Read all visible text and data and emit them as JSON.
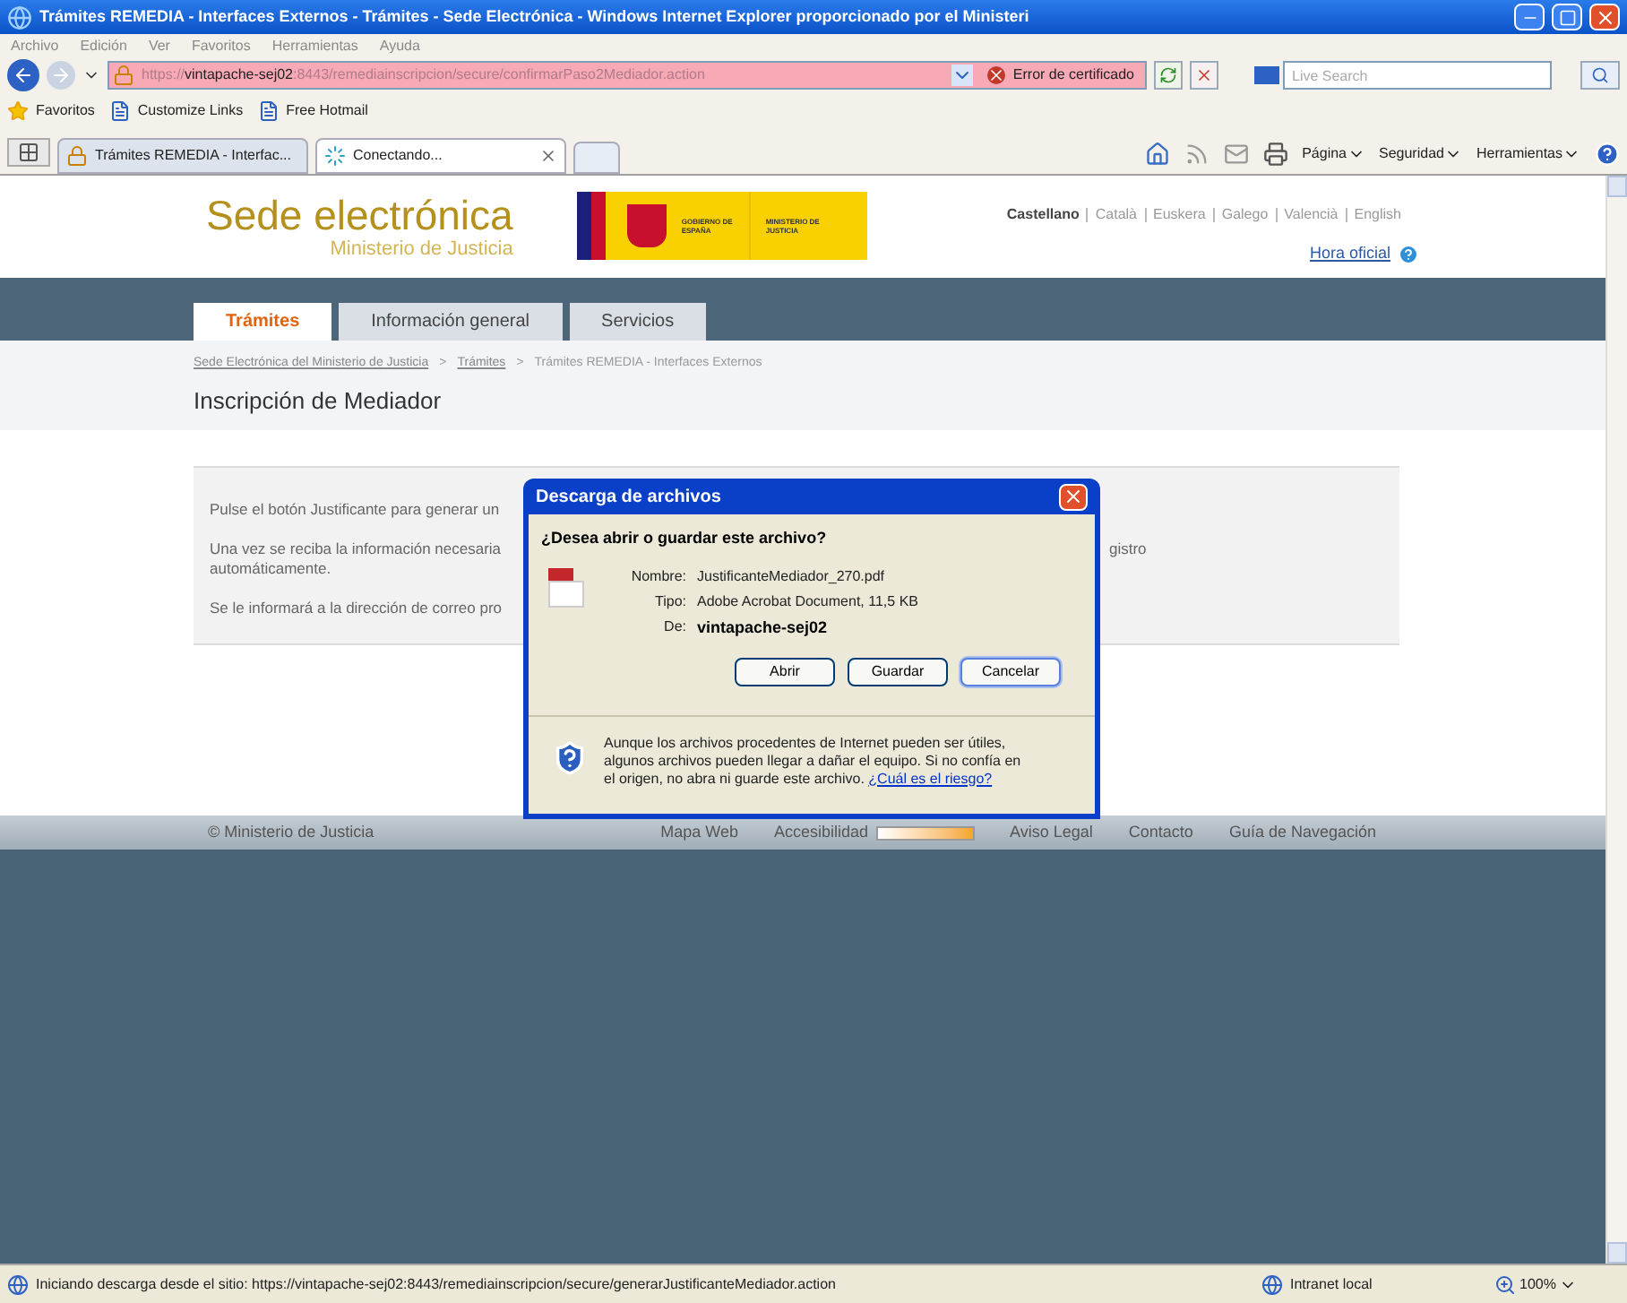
{
  "window": {
    "title": "Trámites REMEDIA - Interfaces Externos - Trámites - Sede Electrónica - Windows Internet Explorer proporcionado por el Ministeri"
  },
  "menu": [
    "Archivo",
    "Edición",
    "Ver",
    "Favoritos",
    "Herramientas",
    "Ayuda"
  ],
  "address_bar": {
    "scheme": "https://",
    "host": "vintapache-sej02",
    "path": ":8443/remediainscripcion/secure/confirmarPaso2Mediador.action",
    "certificate_error": "Error de certificado"
  },
  "search": {
    "placeholder": "Live Search"
  },
  "favorites_bar": [
    "Favoritos",
    "Customize Links",
    "Free Hotmail"
  ],
  "browser_tabs": [
    {
      "label": "Trámites REMEDIA - Interfac...",
      "selected": false
    },
    {
      "label": "Conectando...",
      "selected": true
    }
  ],
  "command_bar": [
    "Página",
    "Seguridad",
    "Herramientas"
  ],
  "page": {
    "site_title": "Sede electrónica",
    "site_subtitle": "Ministerio de Justicia",
    "logo": {
      "left": "GOBIERNO DE ESPAÑA",
      "right": "MINISTERIO DE JUSTICIA"
    },
    "languages": [
      {
        "label": "Castellano",
        "selected": true
      },
      {
        "label": "Català",
        "selected": false
      },
      {
        "label": "Euskera",
        "selected": false
      },
      {
        "label": "Galego",
        "selected": false
      },
      {
        "label": "Valencià",
        "selected": false
      },
      {
        "label": "English",
        "selected": false
      }
    ],
    "official_time": "Hora oficial",
    "nav_tabs": [
      {
        "label": "Trámites",
        "selected": true
      },
      {
        "label": "Información general",
        "selected": false
      },
      {
        "label": "Servicios",
        "selected": false
      }
    ],
    "breadcrumb": [
      {
        "label": "Sede Electrónica del Ministerio de Justicia",
        "link": true
      },
      {
        "label": ">",
        "link": false
      },
      {
        "label": "Trámites",
        "link": true
      },
      {
        "label": ">",
        "link": false
      },
      {
        "label": "Trámites REMEDIA - Interfaces Externos",
        "link": false
      }
    ],
    "heading": "Inscripción de Mediador",
    "paragraphs": [
      [
        {
          "left": "Pulse el botón Justificante para generar un"
        }
      ],
      [
        {
          "left": "Una vez se reciba la información necesaria",
          "right": "gistro"
        },
        {
          "left": "automáticamente."
        }
      ],
      [
        {
          "left": "Se le informará a la dirección de correo pro"
        }
      ]
    ],
    "footer": {
      "copyright": "© Ministerio de Justicia",
      "links": [
        "Mapa Web",
        "Accesibilidad",
        "Aviso Legal",
        "Contacto",
        "Guía de Navegación"
      ]
    }
  },
  "dialog": {
    "title": "Descarga de archivos",
    "question": "¿Desea abrir o guardar este archivo?",
    "fields": [
      {
        "label": "Nombre:",
        "value": "JustificanteMediador_270.pdf",
        "bold": false
      },
      {
        "label": "Tipo:",
        "value": "Adobe Acrobat Document, 11,5 KB",
        "bold": false
      },
      {
        "label": "De:",
        "value": "vintapache-sej02",
        "bold": true
      }
    ],
    "buttons": [
      {
        "label": "Abrir",
        "focused": false
      },
      {
        "label": "Guardar",
        "focused": false
      },
      {
        "label": "Cancelar",
        "focused": true
      }
    ],
    "warning": "Aunque los archivos procedentes de Internet pueden ser útiles, algunos archivos pueden llegar a dañar el equipo. Si no confía en el origen, no abra ni guarde este archivo.",
    "warning_link": "¿Cuál es el riesgo?"
  },
  "status_bar": {
    "text": "Iniciando descarga desde el sitio: https://vintapache-sej02:8443/remediainscripcion/secure/generarJustificanteMediador.action",
    "zone": "Intranet local",
    "zoom": "100%"
  }
}
